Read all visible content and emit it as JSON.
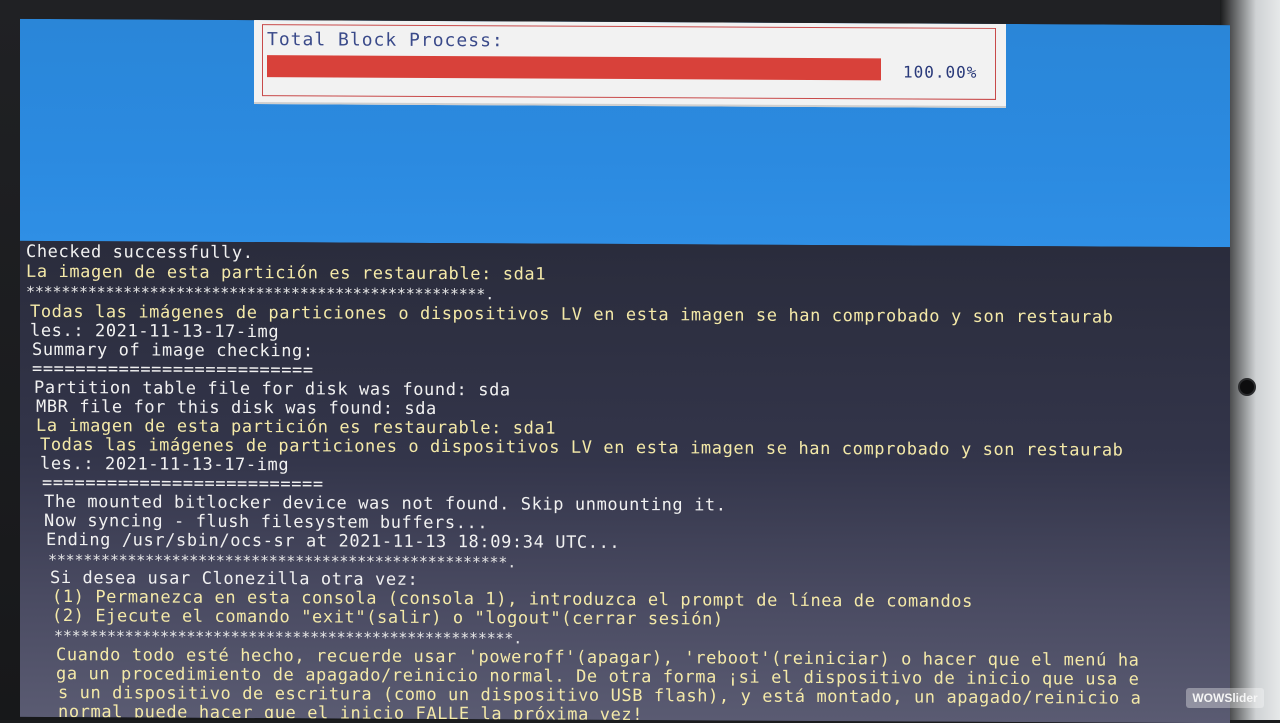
{
  "dialog": {
    "title": "Total Block Process:",
    "progress_fraction": 1.0,
    "progress_text": "100.00%"
  },
  "console_lines": [
    "Checked successfully.",
    "La imagen de esta partición es restaurable: sda1",
    "****************************************************.",
    "Todas las imágenes de particiones o dispositivos LV en esta imagen se han comprobado y son restaurab",
    "les.: 2021-11-13-17-img",
    "Summary of image checking:",
    "==========================",
    "Partition table file for disk was found: sda",
    "MBR file for this disk was found: sda",
    "La imagen de esta partición es restaurable: sda1",
    "Todas las imágenes de particiones o dispositivos LV en esta imagen se han comprobado y son restaurab",
    "les.: 2021-11-13-17-img",
    "==========================",
    "The mounted bitlocker device was not found. Skip unmounting it.",
    "Now syncing - flush filesystem buffers...",
    "Ending /usr/sbin/ocs-sr at 2021-11-13 18:09:34 UTC...",
    "****************************************************.",
    "Si desea usar Clonezilla otra vez:",
    "(1) Permanezca en esta consola (consola 1), introduzca el prompt de línea de comandos",
    "(2) Ejecute el comando \"exit\"(salir) o \"logout\"(cerrar sesión)",
    "****************************************************.",
    "Cuando todo esté hecho, recuerde usar 'poweroff'(apagar), 'reboot'(reiniciar) o hacer que el menú ha",
    "ga un procedimiento de apagado/reinicio normal. De otra forma ¡si el dispositivo de inicio que usa e",
    "s un dispositivo de escritura (como un dispositivo USB flash), y está montado, un apagado/reinicio a",
    "normal puede hacer que el inicio FALLE la próxima vez!",
    "****************************************************."
  ],
  "colors": {
    "white_text": "#f1f1f1",
    "yellow_text": "#f4e9a8",
    "progress_red": "#d8413a",
    "background_blue": "#2b8ae0"
  },
  "watermark": "WOWSlider"
}
